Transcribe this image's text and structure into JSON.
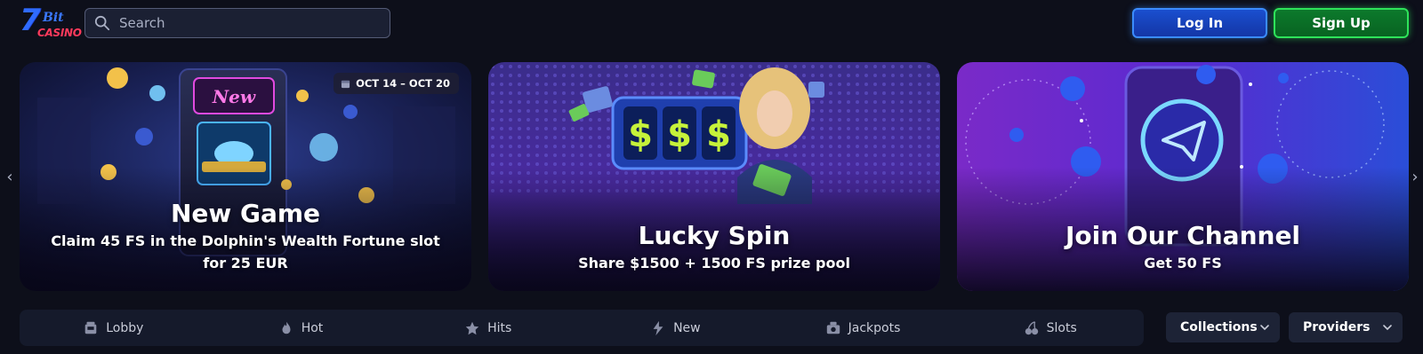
{
  "header": {
    "logo": {
      "number": "7",
      "bit": "Bit",
      "casino": "CASINO"
    },
    "search": {
      "placeholder": "Search"
    },
    "login_label": "Log In",
    "signup_label": "Sign Up"
  },
  "banners": [
    {
      "title": "New Game",
      "subtitle": "Claim 45 FS in the Dolphin's Wealth Fortune slot for 25 EUR",
      "date_badge": "OCT 14 – OCT 20",
      "art_text": "New"
    },
    {
      "title": "Lucky Spin",
      "subtitle": "Share $1500 + 1500 FS prize pool"
    },
    {
      "title": "Join Our Channel",
      "subtitle": "Get 50 FS"
    }
  ],
  "categories": [
    {
      "label": "Lobby",
      "icon": "lobby-icon"
    },
    {
      "label": "Hot",
      "icon": "flame-icon"
    },
    {
      "label": "Hits",
      "icon": "hits-icon"
    },
    {
      "label": "New",
      "icon": "new-icon"
    },
    {
      "label": "Jackpots",
      "icon": "jackpot-icon"
    },
    {
      "label": "Slots",
      "icon": "cherries-icon"
    }
  ],
  "dropdowns": {
    "collections": "Collections",
    "providers": "Providers"
  },
  "colors": {
    "background": "#0d0f1a",
    "login_border": "#3b8cff",
    "signup_border": "#2ee35a",
    "logo_blue": "#2f6bff",
    "logo_red": "#ff3a5c"
  }
}
